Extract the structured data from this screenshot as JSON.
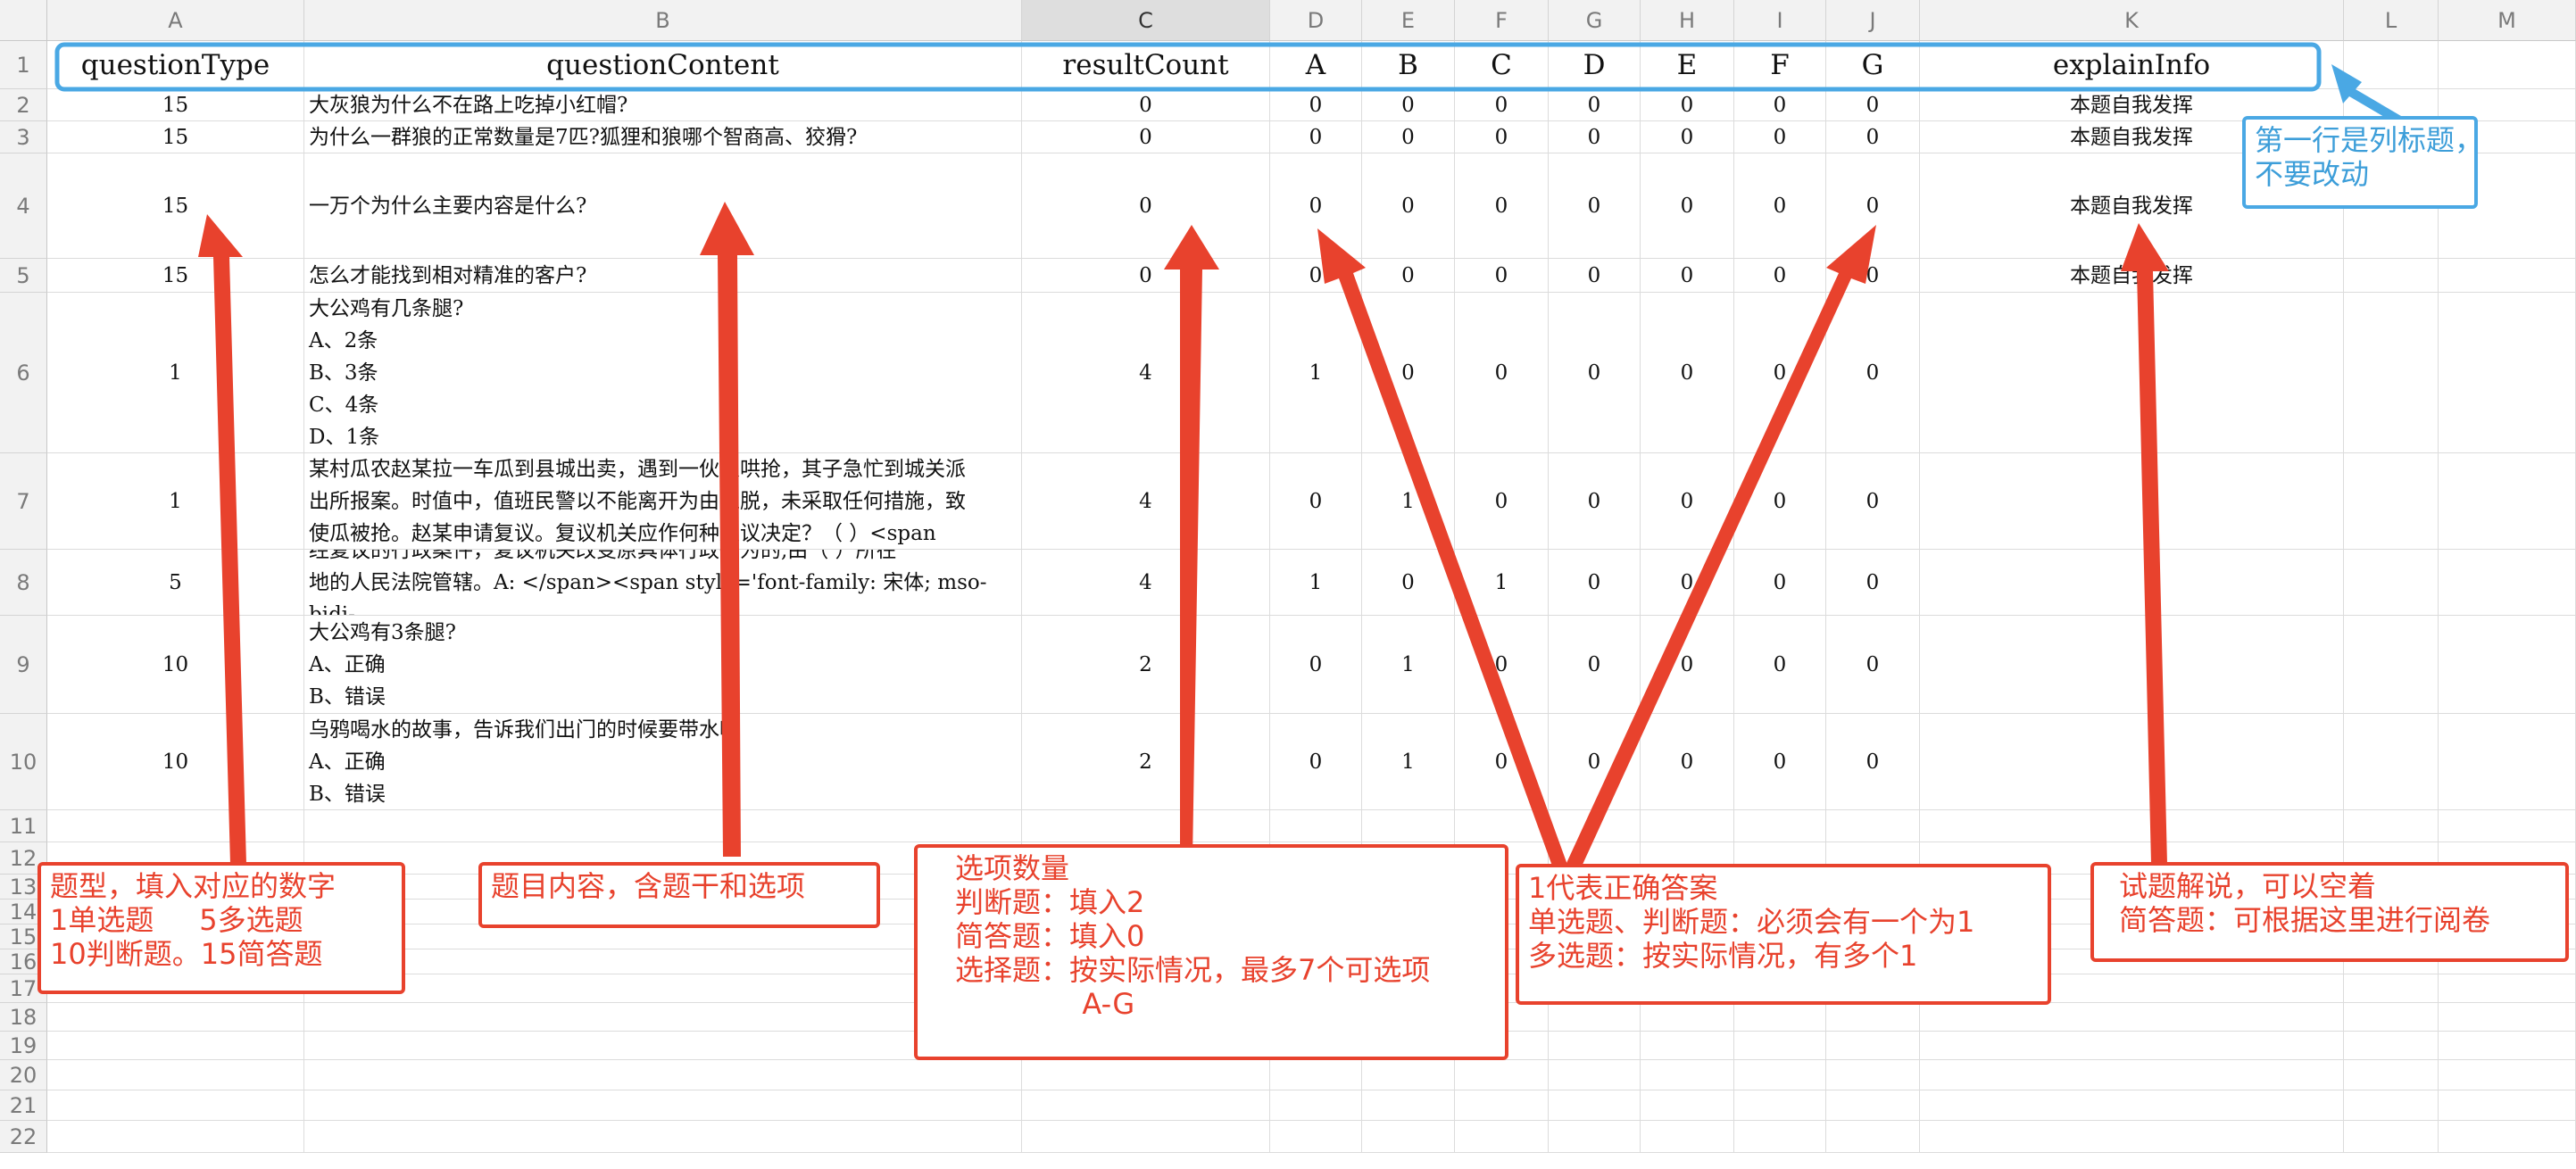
{
  "sheet": {
    "columns": [
      "A",
      "B",
      "C",
      "D",
      "E",
      "F",
      "G",
      "H",
      "I",
      "J",
      "K",
      "L",
      "M"
    ],
    "selected_column": "C",
    "rows": [
      "1",
      "2",
      "3",
      "4",
      "5",
      "6",
      "7",
      "8",
      "9",
      "10",
      "11",
      "12",
      "13",
      "14",
      "15",
      "16",
      "17",
      "18",
      "19",
      "20",
      "21",
      "22"
    ]
  },
  "table": {
    "headers": [
      "questionType",
      "questionContent",
      "resultCount",
      "A",
      "B",
      "C",
      "D",
      "E",
      "F",
      "G",
      "explainInfo"
    ],
    "rows": [
      [
        "15",
        "大灰狼为什么不在路上吃掉小红帽?",
        "0",
        "0",
        "0",
        "0",
        "0",
        "0",
        "0",
        "0",
        "本题自我发挥"
      ],
      [
        "15",
        "为什么一群狼的正常数量是7匹?狐狸和狼哪个智商高、狡猾?",
        "0",
        "0",
        "0",
        "0",
        "0",
        "0",
        "0",
        "0",
        "本题自我发挥"
      ],
      [
        "15",
        "一万个为什么主要内容是什么?",
        "0",
        "0",
        "0",
        "0",
        "0",
        "0",
        "0",
        "0",
        "本题自我发挥"
      ],
      [
        "15",
        "怎么才能找到相对精准的客户?",
        "0",
        "0",
        "0",
        "0",
        "0",
        "0",
        "0",
        "0",
        "本题自我发挥"
      ],
      [
        "1",
        "大公鸡有几条腿?\nA、2条\nB、3条\nC、4条\nD、1条",
        "4",
        "1",
        "0",
        "0",
        "0",
        "0",
        "0",
        "0",
        ""
      ],
      [
        "1",
        "某村瓜农赵某拉一车瓜到县城出卖，遇到一伙人哄抢，其子急忙到城关派\n出所报案。时值中，值班民警以不能离开为由推脱，未采取任何措施，致\n使瓜被抢。赵某申请复议。复议机关应作何种复议决定？（ ）<span",
        "4",
        "0",
        "1",
        "0",
        "0",
        "0",
        "0",
        "0",
        ""
      ],
      [
        "5",
        "经复议的行政案件，复议机关改变原具体行政行为的,由（          ）所在\n地的人民法院管辖。A: </span><span style='font-family: 宋体; mso-bidi-",
        "4",
        "1",
        "0",
        "1",
        "0",
        "0",
        "0",
        "0",
        ""
      ],
      [
        "10",
        "大公鸡有3条腿?\nA、正确\nB、错误",
        "2",
        "0",
        "1",
        "0",
        "0",
        "0",
        "0",
        "0",
        ""
      ],
      [
        "10",
        "乌鸦喝水的故事，告诉我们出门的时候要带水喝\n A、正确\n B、错误",
        "2",
        "0",
        "1",
        "0",
        "0",
        "0",
        "0",
        "0",
        ""
      ]
    ]
  },
  "notes": {
    "header_note": "第一行是列标题，\n不要改动",
    "type_note": "题型，填入对应的数字\n1单选题     5多选题\n10判断题。15简答题",
    "content_note": "题目内容，含题干和选项",
    "count_note": "选项数量\n判断题：填入2\n简答题：填入0\n选择题：按实际情况，最多7个可选项\n              A-G",
    "answer_note": "1代表正确答案\n单选题、判断题：必须会有一个为1\n多选题：按实际情况，有多个1",
    "explain_note": "试题解说，可以空着\n简答题：可根据这里进行阅卷"
  },
  "colors": {
    "annotation_red": "#e8422d",
    "annotation_blue": "#4aa8e4",
    "header_bg": "#f2f2f2",
    "grid": "#dcdcdc"
  }
}
